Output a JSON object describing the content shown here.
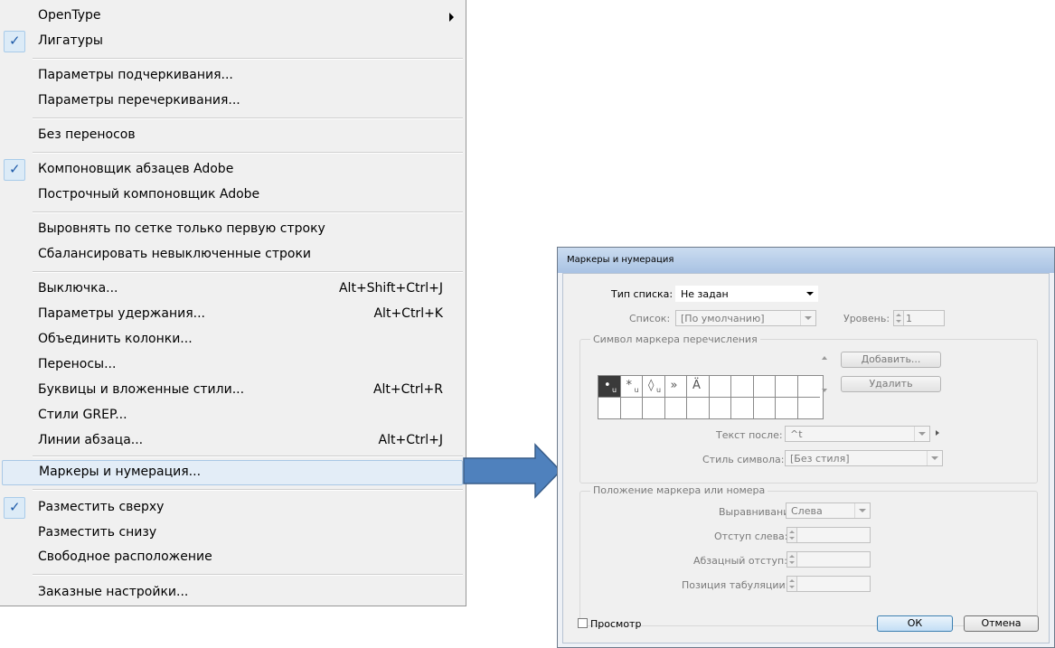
{
  "menu": {
    "items": [
      {
        "label": "OpenType",
        "submenu": true
      },
      {
        "label": "Лигатуры",
        "checked": true
      },
      {
        "label": "Параметры подчеркивания..."
      },
      {
        "label": "Параметры перечеркивания..."
      },
      {
        "label": "Без переносов"
      },
      {
        "label": "Компоновщик абзацев Adobe",
        "checked": true
      },
      {
        "label": "Построчный компоновщик Adobe"
      },
      {
        "label": "Выровнять по сетке только первую строку"
      },
      {
        "label": "Сбалансировать невыключенные строки"
      },
      {
        "label": "Выключка...",
        "shortcut": "Alt+Shift+Ctrl+J"
      },
      {
        "label": "Параметры удержания...",
        "shortcut": "Alt+Ctrl+K"
      },
      {
        "label": "Объединить колонки..."
      },
      {
        "label": "Переносы..."
      },
      {
        "label": "Буквицы и вложенные стили...",
        "shortcut": "Alt+Ctrl+R"
      },
      {
        "label": "Стили GREP..."
      },
      {
        "label": "Линии абзаца...",
        "shortcut": "Alt+Ctrl+J"
      },
      {
        "label": "Маркеры и нумерация...",
        "highlighted": true
      },
      {
        "label": "Разместить сверху",
        "checked": true
      },
      {
        "label": "Разместить снизу"
      },
      {
        "label": "Свободное расположение"
      },
      {
        "label": "Заказные настройки..."
      }
    ],
    "check_glyph": "✓"
  },
  "dialog": {
    "title": "Маркеры и нумерация",
    "list_type_label": "Тип списка:",
    "list_type_value": "Не задан",
    "list_label": "Список:",
    "list_value": "[По умолчанию]",
    "level_label": "Уровень:",
    "level_value": "1",
    "bullet_group_label": "Символ маркера перечисления",
    "bullet_chars": [
      "•",
      "*",
      "◊",
      "»",
      "Ä"
    ],
    "bullet_sub": "u",
    "add_button": "Добавить...",
    "delete_button": "Удалить",
    "text_after_label": "Текст после:",
    "text_after_value": "^t",
    "char_style_label": "Стиль символа:",
    "char_style_value": "[Без стиля]",
    "position_group_label": "Положение маркера или номера",
    "alignment_label": "Выравнивание:",
    "alignment_value": "Слева",
    "left_indent_label": "Отступ слева:",
    "first_indent_label": "Абзацный отступ:",
    "tab_position_label": "Позиция табуляции:",
    "preview_label": "Просмотр",
    "ok_button": "ОК",
    "cancel_button": "Отмена"
  },
  "colors": {
    "arrow_fill": "#4f81bd",
    "arrow_stroke": "#385d8a",
    "menu_bg": "#f0f0f0",
    "highlight": "#e3edf7"
  }
}
